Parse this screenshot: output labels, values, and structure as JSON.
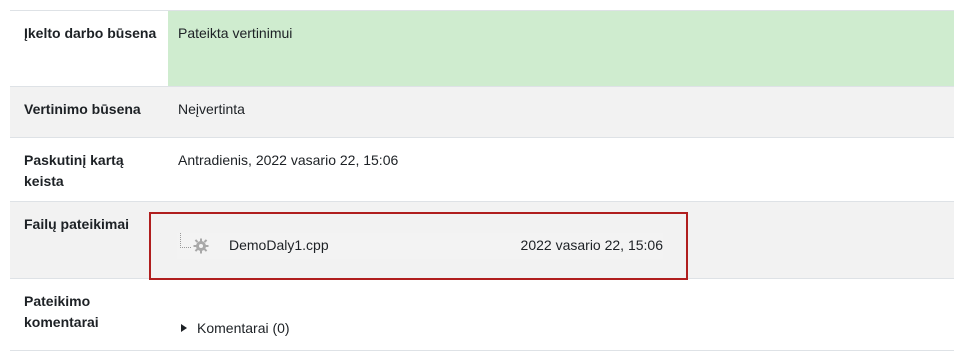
{
  "rows": [
    {
      "label": "Įkelto darbo būsena",
      "value": "Pateikta vertinimui"
    },
    {
      "label": "Vertinimo būsena",
      "value": "Neįvertinta"
    },
    {
      "label": "Paskutinį kartą keista",
      "value": "Antradienis, 2022 vasario 22, 15:06"
    },
    {
      "label": "Failų pateikimai",
      "value": ""
    },
    {
      "label": "Pateikimo komentarai",
      "value": ""
    }
  ],
  "files": [
    {
      "name": "DemoDaly1.cpp",
      "date": "2022 vasario 22, 15:06",
      "icon": "gear-file-icon"
    }
  ],
  "comments": {
    "label": "Komentarai (0)",
    "icon": "caret-right-icon"
  },
  "colors": {
    "submitted_bg": "#cfeccf",
    "highlight_border": "#b01e1e",
    "alt_row_bg": "#f2f2f2"
  }
}
